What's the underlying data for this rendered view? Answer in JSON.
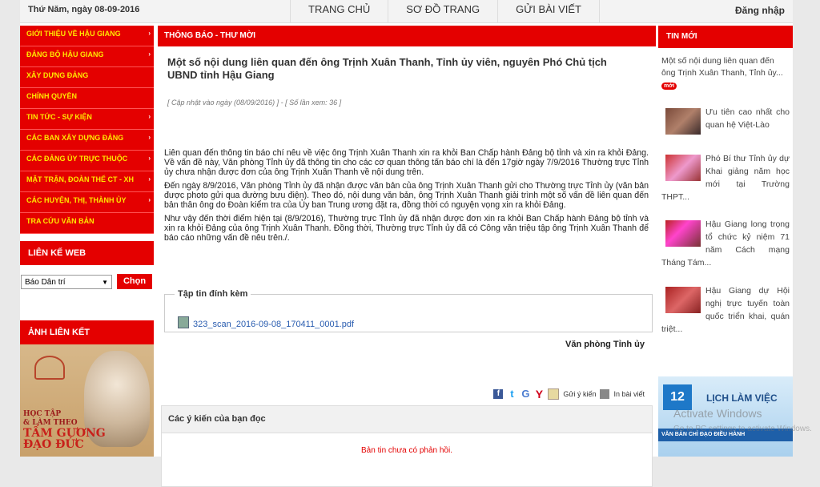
{
  "topbar": {
    "date": "Thứ Năm, ngày 08-09-2016",
    "nav": [
      "TRANG CHỦ",
      "SƠ ĐỒ TRANG",
      "GỬI BÀI VIẾT"
    ],
    "login": "Đăng nhập"
  },
  "left": {
    "menu": [
      {
        "label": "GIỚI THIỆU VỀ HẬU GIANG",
        "arrow": "›"
      },
      {
        "label": "ĐẢNG BỘ HẬU GIANG",
        "arrow": "›"
      },
      {
        "label": "XÂY DỰNG ĐẢNG",
        "arrow": ""
      },
      {
        "label": "CHÍNH QUYỀN",
        "arrow": ""
      },
      {
        "label": "TIN TỨC - SỰ KIỆN",
        "arrow": "›"
      },
      {
        "label": "CÁC BAN XÂY DỰNG ĐẢNG",
        "arrow": "›"
      },
      {
        "label": "CÁC ĐẢNG ỦY TRỰC THUỘC",
        "arrow": "›"
      },
      {
        "label": "MẶT TRẬN, ĐOÀN THỂ CT - XH",
        "arrow": "›"
      },
      {
        "label": "CÁC HUYỆN, THỊ, THÀNH ỦY",
        "arrow": "›"
      },
      {
        "label": "TRA CỨU VĂN BẢN",
        "arrow": ""
      }
    ],
    "links_title": "LIÊN KẾ WEB",
    "select_value": "Báo Dân trí",
    "go_button": "Chọn",
    "photo_title": "ẢNH LIÊN KẾT",
    "banner_line1": "HỌC TẬP",
    "banner_line2": "& LÀM THEO",
    "banner_line3": "TẤM GƯƠNG",
    "banner_line4": "ĐẠO ĐỨC"
  },
  "main": {
    "section": "THÔNG BÁO - THƯ MỜI",
    "title": "Một số nội dung liên quan đến ông Trịnh Xuân Thanh, Tỉnh ủy viên, nguyên Phó Chủ tịch UBND tỉnh Hậu Giang",
    "update": "[ Cập nhật vào ngày (08/09/2016) ] - [ Số lần xem: 36 ]",
    "paragraphs": [
      "Liên quan đến thông tin báo chí nêu về việc ông Trịnh Xuân Thanh xin ra khỏi Ban Chấp hành Đảng bộ tỉnh và xin ra khỏi Đảng. Về vấn đề này, Văn phòng Tỉnh ủy đã thông tin cho các cơ quan thông tấn báo chí là đến 17giờ ngày 7/9/2016 Thường trực Tỉnh ủy chưa nhận được đơn của ông Trịnh Xuân Thanh về nội dung trên.",
      "Đến ngày 8/9/2016, Văn phòng Tỉnh ủy đã nhận được văn bản của ông Trịnh Xuân Thanh gửi cho Thường trực Tỉnh ủy (văn bản được photo gửi qua đường bưu điện). Theo đó, nội dung văn bản, ông Trịnh Xuân Thanh giải trình một số vấn đề liên quan đến bản thân ông do Đoàn kiểm tra của Ủy ban Trung ương đặt ra, đồng thời có nguyện vọng xin ra khỏi Đảng.",
      "Như vậy đến thời điểm hiện tại (8/9/2016), Thường trực Tỉnh ủy đã nhận được đơn xin ra khỏi Ban Chấp hành Đảng bộ tỉnh và xin ra khỏi Đảng của ông Trịnh Xuân Thanh. Đồng thời, Thường trực Tỉnh ủy đã có Công văn triệu tập ông Trịnh Xuân Thanh để báo cáo những vấn đề nêu trên./."
    ],
    "attach_label": "Tập tin đính kèm",
    "attach_file": "323_scan_2016-09-08_170411_0001.pdf",
    "author": "Văn phòng Tỉnh ủy",
    "send_comment": "Gửi ý kiến",
    "print": "In bài viết",
    "comments_title": "Các ý kiến của bạn đọc",
    "comments_empty": "Bản tin chưa có phản hồi."
  },
  "right": {
    "title": "TIN MỚI",
    "first": "Một số nội dung liên quan đến ông Trịnh Xuân Thanh, Tỉnh ủy...",
    "new_badge": "mới",
    "items": [
      "Ưu tiên cao nhất cho quan hệ Việt-Lào",
      "Phó Bí thư Tỉnh ủy dự Khai giảng năm học mới tại Trường THPT...",
      "Hậu Giang long trọng tổ chức kỷ niệm 71 năm Cách mạng Tháng Tám...",
      "Hậu Giang dự Hội nghị trực tuyến toàn quốc triển khai, quán triệt..."
    ],
    "calendar_num": "12",
    "calendar_title": "LỊCH LÀM VIỆC",
    "strip": "VĂN BẢN CHỈ ĐẠO ĐIỀU HÀNH"
  },
  "watermark": {
    "line1": "Activate Windows",
    "line2": "Go to PC settings to activate Windows."
  },
  "colors": {
    "brand_red": "#e40000",
    "menu_text": "#ffe600"
  }
}
